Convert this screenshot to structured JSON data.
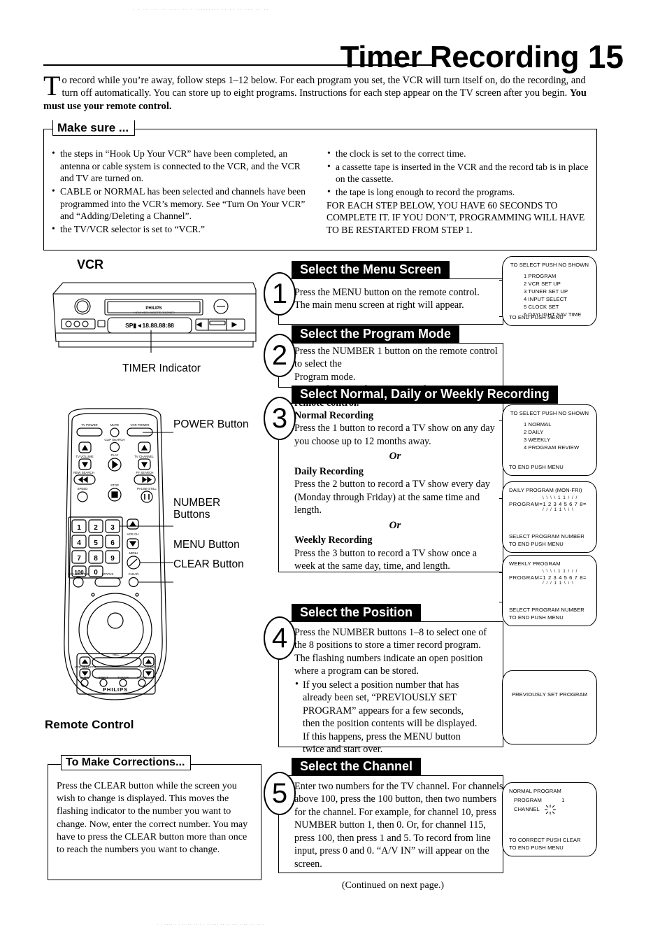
{
  "header": {
    "title": "Timer Recording",
    "page_number": "15"
  },
  "intro": {
    "dropcap": "T",
    "text_1": "o record while you’re away, follow steps 1–12 below. For each program you set, the VCR will turn itself on, do the recording, and turn off automatically. You can store up to eight programs. Instructions for each step appear on the TV screen after you begin. ",
    "text_bold": "You must use your remote control."
  },
  "make_sure": {
    "tab_label": "Make sure ...",
    "left_items": [
      "the steps in “Hook Up Your VCR” have been completed, an antenna or cable system is connected to the VCR, and the VCR and TV are turned on.",
      "CABLE or NORMAL has been selected and channels have been programmed into the VCR’s memory. See “Turn On Your VCR” and “Adding/Deleting a Channel”.",
      "the TV/VCR selector is set to “VCR.”"
    ],
    "right_items": [
      "the clock is set to the correct time.",
      "a cassette tape is inserted in the VCR and the record tab is in place on the cassette.",
      "the tape is long enough to record the programs."
    ],
    "caps_note": "FOR EACH STEP BELOW, YOU HAVE 60 SECONDS TO COMPLETE IT. IF YOU DON’T, PROGRAMMING WILL HAVE TO BE RESTARTED FROM STEP 1."
  },
  "figures": {
    "vcr_label": "VCR",
    "vcr_brand": "PHILIPS",
    "vcr_display": "18.88.88:88",
    "timer_indicator_label": "TIMER Indicator",
    "remote_label": "Remote Control",
    "remote_brand": "PHILIPS",
    "callouts": {
      "power": "POWER Button",
      "number_line1": "NUMBER",
      "number_line2": "Buttons",
      "menu": "MENU Button",
      "clear": "CLEAR Button"
    },
    "remote_keys": [
      "1",
      "2",
      "3",
      "4",
      "5",
      "6",
      "7",
      "8",
      "9",
      "100",
      "0"
    ],
    "remote_top_labels": [
      "TV POWER",
      "MUTE",
      "VCR POWER",
      "CLIP SEARCH",
      "TV VOLUME",
      "TV CHANNEL",
      "PLAY",
      "REW SEARCH",
      "FF SEARCH",
      "SPEED",
      "STOP",
      "PAUSE-STILL",
      "VCR CH",
      "MENU",
      "JOG-SHUTTLE",
      "STATUS",
      "CLEAR"
    ],
    "remote_bottom_labels": [
      "REC",
      "VCR SELECTS",
      "TRACKING",
      "SLOW",
      "EJECT",
      "TV/VCR",
      "MONO"
    ]
  },
  "steps": [
    {
      "number": "1",
      "heading": "Select the Menu Screen",
      "lines": [
        "Press the MENU button on the remote control.",
        "The main menu screen at right will appear."
      ]
    },
    {
      "number": "2",
      "heading": "Select the Program Mode",
      "lines": [
        "Press the NUMBER 1 button on the remote control to select the",
        "Program mode."
      ],
      "bold_line": "Remember, use the NUMBER buttons on your remote control."
    },
    {
      "number": "3",
      "heading": "Select Normal, Daily or Weekly Recording",
      "normal_title": "Normal Recording",
      "normal_text": "Press the 1 button to record a TV show on any day you choose up to 12 months away.",
      "or_1": "Or",
      "daily_title": "Daily Recording",
      "daily_text": "Press the 2 button to record a TV show every day (Monday through Friday) at the same time and length.",
      "or_2": "Or",
      "weekly_title": "Weekly Recording",
      "weekly_text": "Press the 3 button to record a TV show once a week at the same day, time, and length."
    },
    {
      "number": "4",
      "heading": "Select the Position",
      "text": "Press the NUMBER buttons 1–8 to select one of the 8 positions to store a timer record program. The flashing numbers indicate an open position where a program can be stored.",
      "bullet": "If you select a position number that has already been set, “PREVIOUSLY SET PROGRAM” appears for a few seconds, then the position contents will be displayed. If this happens, press the MENU button twice and start over."
    },
    {
      "number": "5",
      "heading": "Select the Channel",
      "text": "Enter two numbers for the TV channel. For channels above 100, press the 100 button, then two numbers for the channel. For example, for channel 10, press NUMBER button 1, then 0. Or, for channel 115, press 100, then press 1 and 5. To record from line input, press 0 and 0. “A/V IN” will appear on the screen."
    }
  ],
  "tv_screens": [
    {
      "id": "main-menu",
      "top": "TO SELECT PUSH NO  SHOWN",
      "items": [
        "1 PROGRAM",
        "2 VCR SET UP",
        "3 TUNER SET UP",
        "4 INPUT SELECT",
        "5 CLOCK SET",
        "6 DAYLIGHT SAV  TIME"
      ],
      "bottom": "TO END PUSH MENU"
    },
    {
      "id": "program-mode-menu",
      "top": "TO SELECT PUSH NO  SHOWN",
      "items": [
        "1 NORMAL",
        "2 DAILY",
        "3 WEEKLY",
        "4 PROGRAM REVIEW"
      ],
      "bottom": "TO END PUSH MENU"
    },
    {
      "id": "daily-program",
      "top": "DAILY PROGRAM  (MON-FRI)",
      "program_label": "PROGRAM=",
      "program_numbers": "1 2 3 4 5 6 7 8",
      "program_suffix": "=",
      "flash_above": "\\ \\ \\ \\ 1 1 / / /",
      "flash_below": "/ / / 1 1 \\ \\ \\",
      "bottom_1": "SELECT PROGRAM NUMBER",
      "bottom_2": "TO END PUSH MENU"
    },
    {
      "id": "weekly-program",
      "top": "WEEKLY PROGRAM",
      "program_label": "PROGRAM=",
      "program_numbers": "1 2 3 4 5 6 7 8",
      "program_suffix": "=",
      "flash_above": "\\ \\ \\ \\ 1 1 / / /",
      "flash_below": "/ / / 1 1 \\ \\ \\",
      "bottom_1": "SELECT PROGRAM NUMBER",
      "bottom_2": "TO END PUSH MENU"
    },
    {
      "id": "previously-set",
      "center": "PREVIOUSLY SET PROGRAM"
    },
    {
      "id": "normal-program",
      "top": "NORMAL PROGRAM",
      "row_1_label": "PROGRAM",
      "row_1_value": "1",
      "row_2_label": "CHANNEL",
      "row_2_value": "flashing",
      "bottom_1": "TO CORRECT PUSH CLEAR",
      "bottom_2": "TO END PUSH MENU"
    }
  ],
  "corrections": {
    "tab_label": "To Make Corrections...",
    "text": "Press the CLEAR button while the screen you wish to change is displayed. This moves the flashing indicator to the number you want to change. Now, enter the correct number. You may have to press the CLEAR button more than once to reach the numbers you want to change."
  },
  "footer": {
    "text": "(Continued on next page.)"
  },
  "colors": {
    "ink": "#000000",
    "paper": "#ffffff",
    "header_bar": "#000000"
  }
}
